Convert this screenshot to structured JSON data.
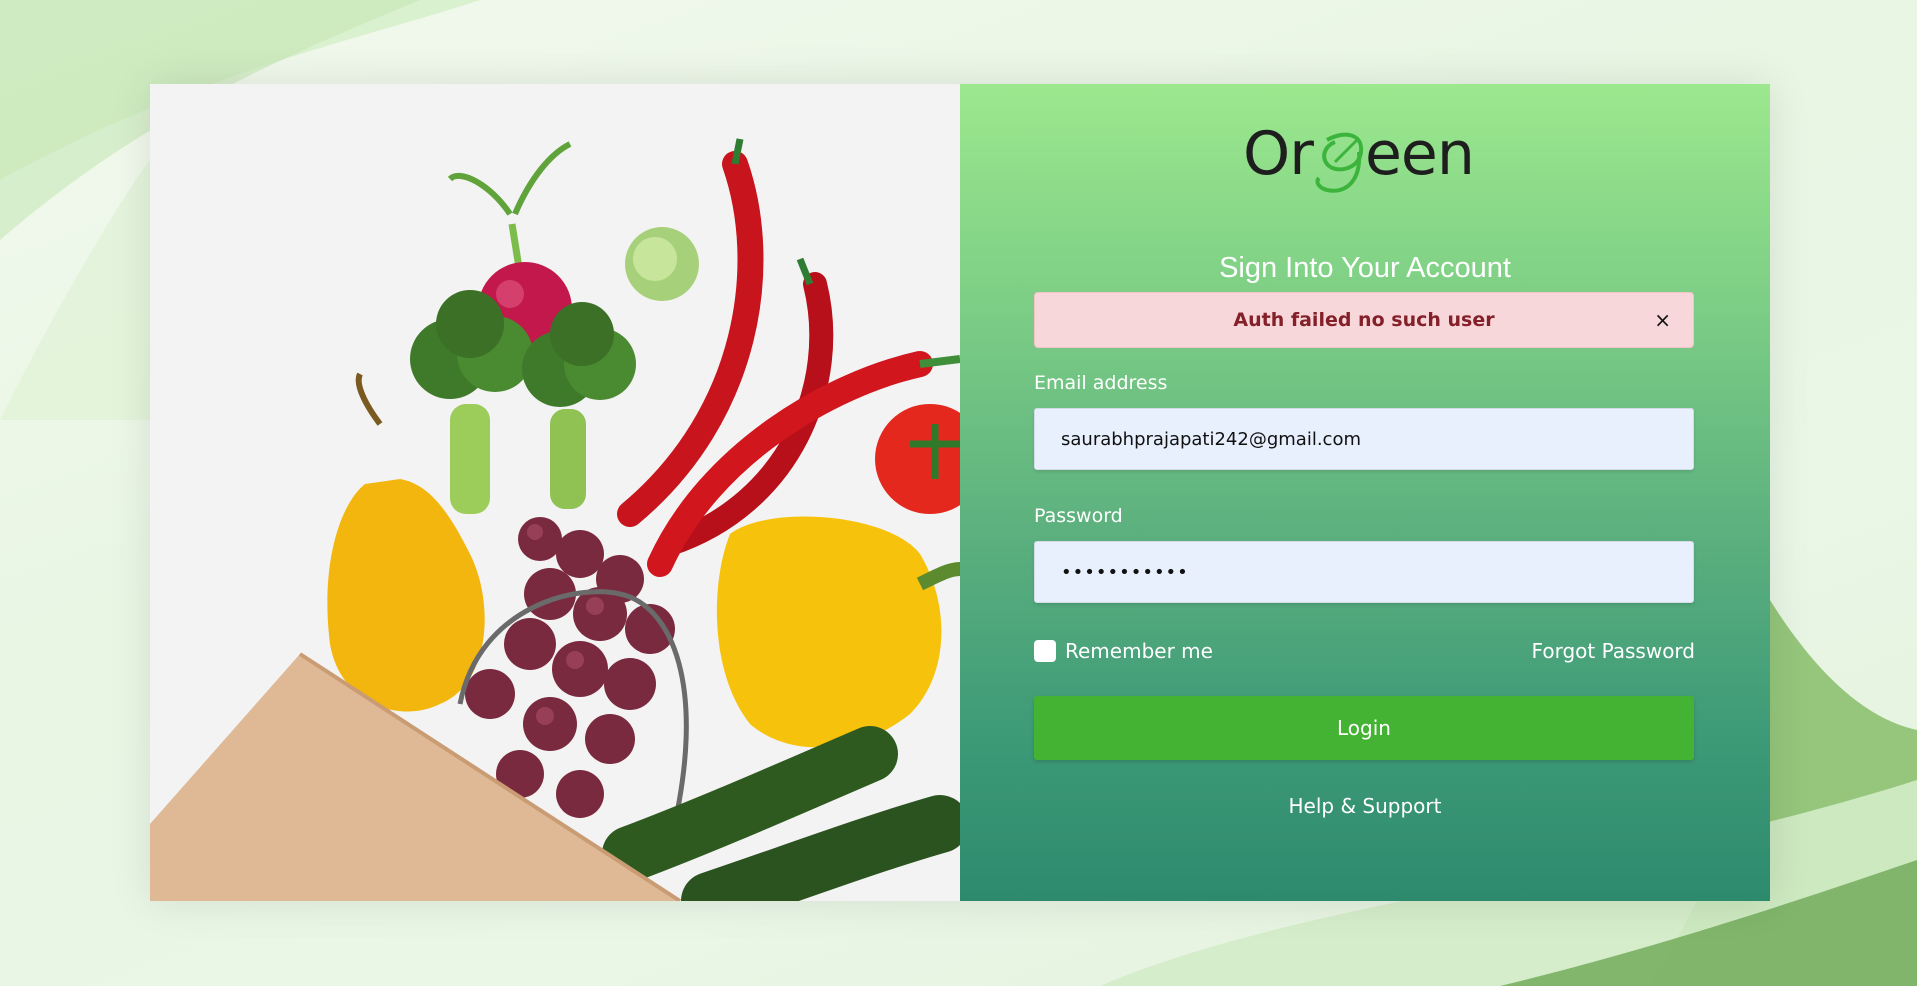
{
  "brand": {
    "logo_text_left": "Or",
    "logo_text_right": "een",
    "logo_letter_icon": "leaf-g-icon",
    "text_color": "#1e1e1e",
    "leaf_color": "#3cb43c"
  },
  "form": {
    "title": "Sign Into Your Account",
    "alert": {
      "message": "Auth failed no such user",
      "close_label": "×",
      "bg_color": "#f8d7da",
      "text_color": "#842029"
    },
    "email": {
      "label": "Email address",
      "value": "saurabhprajapati242@gmail.com",
      "placeholder": ""
    },
    "password": {
      "label": "Password",
      "value": "..........."
    },
    "remember_label": "Remember me",
    "remember_checked": false,
    "forgot_label": "Forgot Password",
    "login_label": "Login",
    "help_label": "Help & Support"
  },
  "colors": {
    "panel_gradient_top": "#9ce88e",
    "panel_gradient_bottom": "#2e8a6d",
    "login_button": "#44b232",
    "input_bg": "#e8f0fe"
  },
  "photo": {
    "subject": "vegetables-spilling-from-paper-bag-image"
  }
}
